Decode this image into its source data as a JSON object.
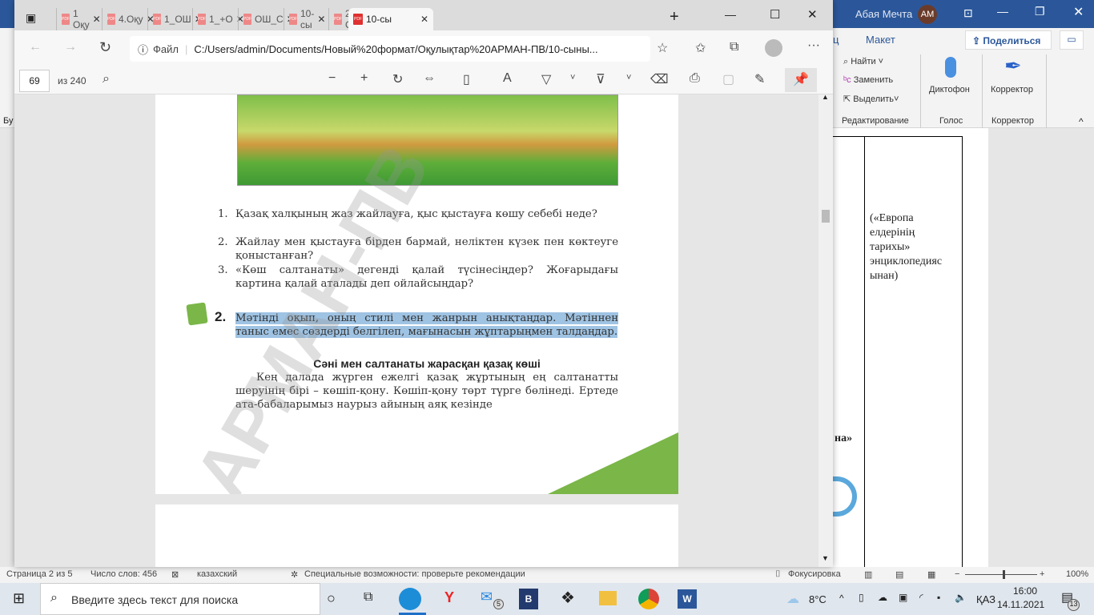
{
  "word": {
    "user": "Абая Мечта",
    "avatar": "AM",
    "tabs": [
      "ц",
      "Макет"
    ],
    "share_label": "Поделиться",
    "editing": {
      "find": "Найти",
      "replace": "Заменить",
      "select": "Выделить",
      "group": "Редактирование"
    },
    "voice": {
      "dictate": "Диктофон",
      "group": "Голос"
    },
    "editor": {
      "label": "Корректор",
      "group": "Корректор"
    },
    "left_cut": "Бу",
    "doc_text": [
      "(«Европа",
      "елдерінің",
      "тарихы»",
      "энциклопедияс",
      "ынан)"
    ],
    "doc_fragment": "на»",
    "status": {
      "page": "Страница 2 из 5",
      "words": "Число слов: 456",
      "language": "казахский",
      "accessibility": "Специальные возможности: проверьте рекомендации",
      "focus": "Фокусировка",
      "zoom": "100%"
    }
  },
  "browser": {
    "tabs": [
      {
        "label": "1 Оқу"
      },
      {
        "label": "4.Оқу"
      },
      {
        "label": "1_ОШ"
      },
      {
        "label": "1_+О"
      },
      {
        "label": "ОШ_С"
      },
      {
        "label": "10-сы"
      },
      {
        "label": "2. Оқ"
      },
      {
        "label": "10-сы",
        "active": true
      }
    ],
    "url_prefix": "Файл",
    "url": "C:/Users/admin/Documents/Новый%20формат/Оқулықтар%20АРМАН-ПВ/10-сыны...",
    "pdf": {
      "page": "69",
      "of": "из 240"
    }
  },
  "pdf_page": {
    "questions": [
      {
        "n": "1.",
        "text": "Қазақ халқының жаз жайлауға, қыс қыстауға көшу себебі неде?"
      },
      {
        "n": "2.",
        "text": "Жайлау мен қыстауға бірден бармай, неліктен күзек пен көктеуге қоныстанған?"
      },
      {
        "n": "3.",
        "text": "«Көш салтанаты» дегенді қалай түсінесіңдер? Жоғарыдағы картина қалай аталады деп ойлайсыңдар?"
      }
    ],
    "task_number": "2.",
    "task_text": "Мәтінді оқып, оның стилі мен жанрын анықтаңдар. Мәтіннен таныс емес сөздерді белгілеп, мағынасын жұптарыңмен талдаңдар.",
    "heading": "Сәні мен салтанаты жарасқан қазақ көші",
    "body": "Кең далада жүрген ежелгі қазақ жұртының ең салтанатты шеруінің бірі – көшіп-қону. Көшіп-қону төрт түрге бөлінеді. Ертеде ата-бабаларымыз наурыз айының аяқ кезінде",
    "page_number": "69",
    "watermark": "АРМАН-ПВ"
  },
  "taskbar": {
    "search_placeholder": "Введите здесь текст для поиска",
    "weather": "8°C",
    "lang": "ҚАЗ",
    "time": "16:00",
    "date": "14.11.2021",
    "mail_badge": "5",
    "notif_badge": "13"
  },
  "colors": {
    "word_blue": "#2b579a",
    "highlight": "#9fc3e3",
    "page_green": "#7ab648"
  }
}
